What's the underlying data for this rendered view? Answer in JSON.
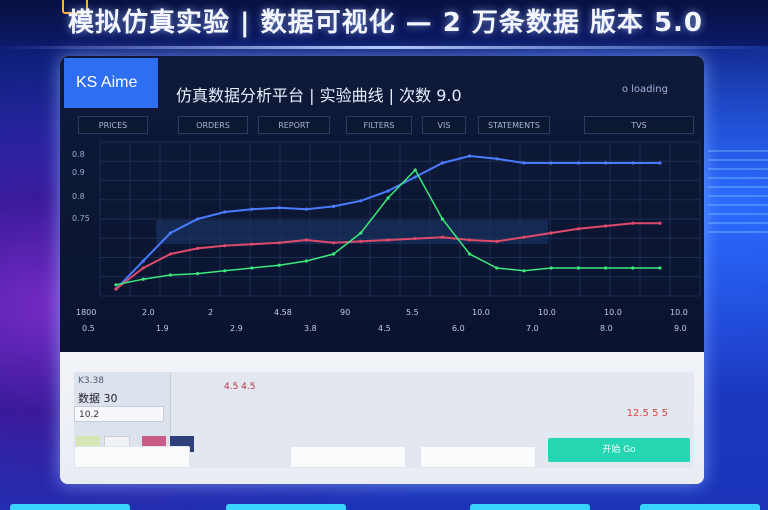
{
  "banner": {
    "title": "模拟仿真实验 | 数据可视化 — 2 万条数据 版本 5.0"
  },
  "panel": {
    "logo": "KS Aime",
    "title": "仿真数据分析平台 | 实验曲线 | 次数 9.0",
    "status": "o loading"
  },
  "tabs": [
    "PRICES",
    "ORDERS",
    "REPORT",
    "FILTERS",
    "VIS",
    "STATEMENTS",
    "TVS"
  ],
  "y_axis_labels": [
    "0.8",
    "0.9",
    "0.8",
    "0.75"
  ],
  "x_axis_top": [
    "1800",
    "2.0",
    "2",
    "4.58",
    "90",
    "5.5",
    "10.0",
    "10.0",
    "10.0",
    "10.0"
  ],
  "x_axis_bottom": [
    "0.5",
    "1.9",
    "2.9",
    "3.8",
    "4.5",
    "6.0",
    "7.0",
    "8.0",
    "9.0"
  ],
  "lower": {
    "card_title": "K3.38",
    "card_value": "数据 30",
    "input_value": "10.2",
    "small_caption": "4.5 4.5",
    "right_numbers": "12.5 5 5",
    "primary_button": "开始 Go"
  },
  "colors": {
    "accent": "#2e6ef0",
    "primary_button": "#25d6b2",
    "line_blue": "#4a7bff",
    "line_red": "#e04a6a",
    "line_green": "#3bea7a"
  },
  "chart_data": {
    "type": "line",
    "x": [
      0,
      1,
      2,
      3,
      4,
      5,
      6,
      7,
      8,
      9,
      10,
      11,
      12,
      13,
      14,
      15,
      16,
      17,
      18,
      19,
      20
    ],
    "series": [
      {
        "values": [
          0.05,
          0.25,
          0.45,
          0.55,
          0.6,
          0.62,
          0.63,
          0.62,
          0.64,
          0.68,
          0.75,
          0.85,
          0.95,
          1.0,
          0.98,
          0.95,
          0.95,
          0.95,
          0.95,
          0.95,
          0.95
        ]
      },
      {
        "values": [
          0.05,
          0.2,
          0.3,
          0.34,
          0.36,
          0.37,
          0.38,
          0.4,
          0.38,
          0.39,
          0.4,
          0.41,
          0.42,
          0.4,
          0.39,
          0.42,
          0.45,
          0.48,
          0.5,
          0.52,
          0.52
        ]
      },
      {
        "values": [
          0.08,
          0.12,
          0.15,
          0.16,
          0.18,
          0.2,
          0.22,
          0.25,
          0.3,
          0.45,
          0.7,
          0.9,
          0.55,
          0.3,
          0.2,
          0.18,
          0.2,
          0.2,
          0.2,
          0.2,
          0.2
        ]
      }
    ],
    "ylim": [
      0,
      1.1
    ]
  }
}
